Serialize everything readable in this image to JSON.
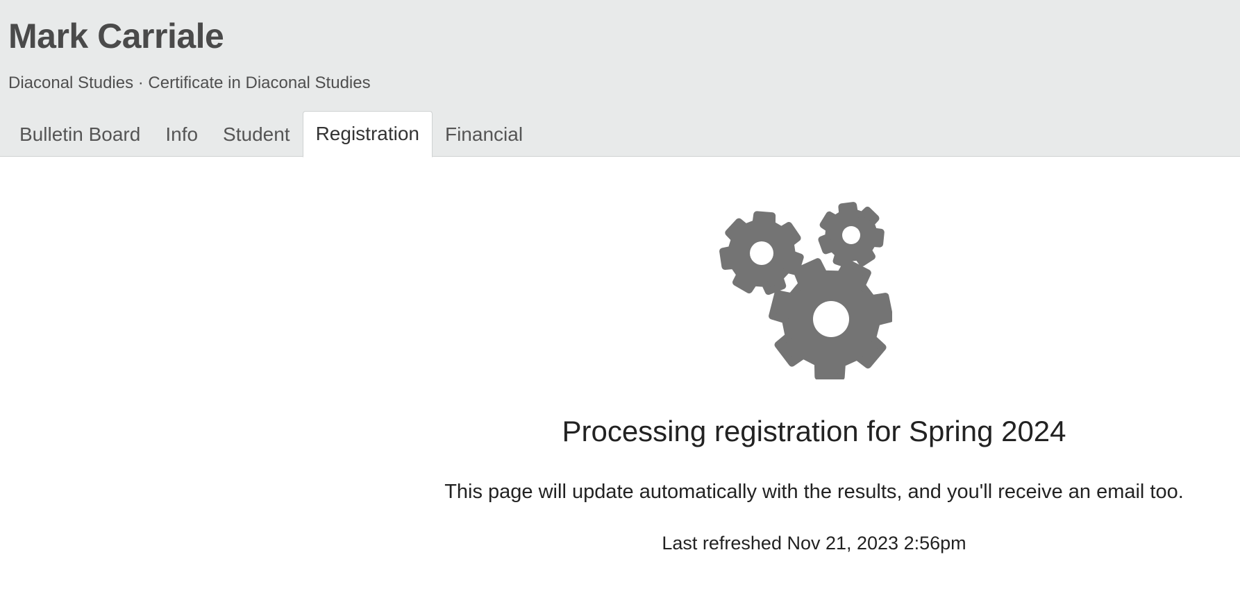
{
  "student": {
    "name": "Mark Carriale",
    "program": "Diaconal Studies · Certificate in Diaconal Studies"
  },
  "tabs": [
    {
      "label": "Bulletin Board",
      "active": false
    },
    {
      "label": "Info",
      "active": false
    },
    {
      "label": "Student",
      "active": false
    },
    {
      "label": "Registration",
      "active": true
    },
    {
      "label": "Financial",
      "active": false
    }
  ],
  "status": {
    "icon": "gears-icon",
    "title": "Processing registration for Spring 2024",
    "message": "This page will update automatically with the results, and you'll receive an email too.",
    "last_refreshed": "Last refreshed Nov 21, 2023 2:56pm"
  },
  "colors": {
    "header_bg": "#e8eaea",
    "icon": "#747474",
    "text": "#222222"
  }
}
